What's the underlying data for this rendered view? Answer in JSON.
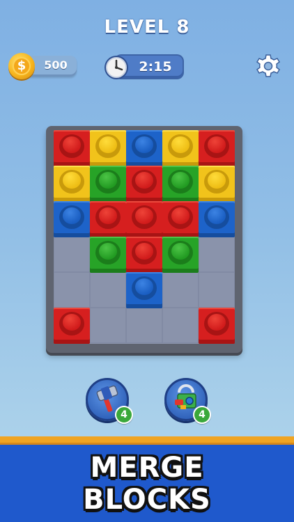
{
  "header": {
    "level_label": "LEVEL 8"
  },
  "coins": {
    "value": "500",
    "icon": "coin-icon",
    "symbol": "$"
  },
  "timer": {
    "value": "2:15",
    "icon": "clock-icon"
  },
  "settings": {
    "icon": "gear-icon"
  },
  "board": {
    "columns": 5,
    "rows": 6,
    "bricks": [
      [
        "red",
        "yellow",
        "blue",
        "yellow",
        "red"
      ],
      [
        "yellow",
        "green",
        "red",
        "green",
        "yellow"
      ],
      [
        "blue",
        "red",
        "red",
        "red",
        "blue"
      ],
      [
        null,
        "green",
        "red",
        "green",
        null
      ],
      [
        null,
        null,
        "blue",
        null,
        null
      ],
      [
        "red",
        null,
        null,
        null,
        "red"
      ]
    ]
  },
  "boosters": [
    {
      "name": "hammer",
      "icon": "hammer-icon",
      "count": "4"
    },
    {
      "name": "magnet",
      "icon": "magnet-icon",
      "count": "4"
    }
  ],
  "banner": {
    "line1": "MERGE",
    "line2": "BLOCKS"
  },
  "colors": {
    "red": "#d61f1f",
    "yellow": "#f1c31b",
    "blue": "#1d63c9",
    "green": "#27a327",
    "banner": "#1f59cc",
    "stripe": "#f0a422"
  }
}
